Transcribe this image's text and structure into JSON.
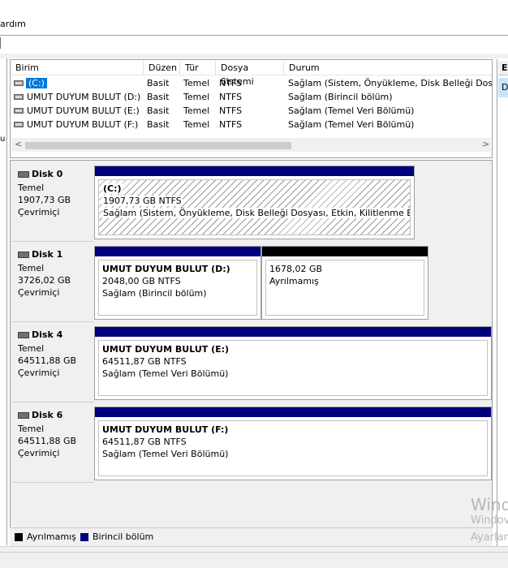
{
  "menu": {
    "label": "ardım"
  },
  "volume_list": {
    "headers": [
      "Birim",
      "Düzen",
      "Tür",
      "Dosya Sistemi",
      "Durum"
    ],
    "rows": [
      {
        "name": "(C:)",
        "layout": "Basit",
        "type": "Temel",
        "fs": "NTFS",
        "status": "Sağlam (Sistem, Önyükleme, Disk Belleği Dosyası"
      },
      {
        "name": "UMUT DUYUM BULUT (D:)",
        "layout": "Basit",
        "type": "Temel",
        "fs": "NTFS",
        "status": "Sağlam (Birincil bölüm)"
      },
      {
        "name": "UMUT DUYUM BULUT (E:)",
        "layout": "Basit",
        "type": "Temel",
        "fs": "NTFS",
        "status": "Sağlam (Temel Veri Bölümü)"
      },
      {
        "name": "UMUT DUYUM BULUT (F:)",
        "layout": "Basit",
        "type": "Temel",
        "fs": "NTFS",
        "status": "Sağlam (Temel Veri Bölümü)"
      }
    ],
    "scroll_left": "<",
    "scroll_right": ">"
  },
  "right_pane": {
    "header": "E",
    "selected": "D"
  },
  "left_pane": {
    "glyph": "u"
  },
  "disks": [
    {
      "name": "Disk 0",
      "type": "Temel",
      "size": "1907,73 GB",
      "state": "Çevrimiçi",
      "partitions": [
        {
          "title": "(C:)",
          "size": "1907,73 GB NTFS",
          "status": "Sağlam (Sistem, Önyükleme, Disk Belleği Dosyası, Etkin, Kilitlenme Bilgisi"
        }
      ]
    },
    {
      "name": "Disk 1",
      "type": "Temel",
      "size": "3726,02 GB",
      "state": "Çevrimiçi",
      "partitions": [
        {
          "title": "UMUT DUYUM BULUT  (D:)",
          "size": "2048,00 GB NTFS",
          "status": "Sağlam (Birincil bölüm)"
        },
        {
          "title": "",
          "size": "1678,02 GB",
          "status": "Ayrılmamış"
        }
      ]
    },
    {
      "name": "Disk 4",
      "type": "Temel",
      "size": "64511,88 GB",
      "state": "Çevrimiçi",
      "partitions": [
        {
          "title": "UMUT DUYUM BULUT  (E:)",
          "size": "64511,87 GB NTFS",
          "status": "Sağlam (Temel Veri Bölümü)"
        }
      ]
    },
    {
      "name": "Disk 6",
      "type": "Temel",
      "size": "64511,88 GB",
      "state": "Çevrimiçi",
      "partitions": [
        {
          "title": "UMUT DUYUM BULUT  (F:)",
          "size": "64511,87 GB NTFS",
          "status": "Sağlam (Temel Veri Bölümü)"
        }
      ]
    }
  ],
  "legend": {
    "unallocated": "Ayrılmamış",
    "primary": "Birincil bölüm"
  },
  "colors": {
    "primary": "#00007f",
    "unallocated": "#000000",
    "selection": "#0078d7"
  },
  "watermark": {
    "line1": "Wind",
    "line2": "Windov",
    "line3": "Ayarlar"
  }
}
